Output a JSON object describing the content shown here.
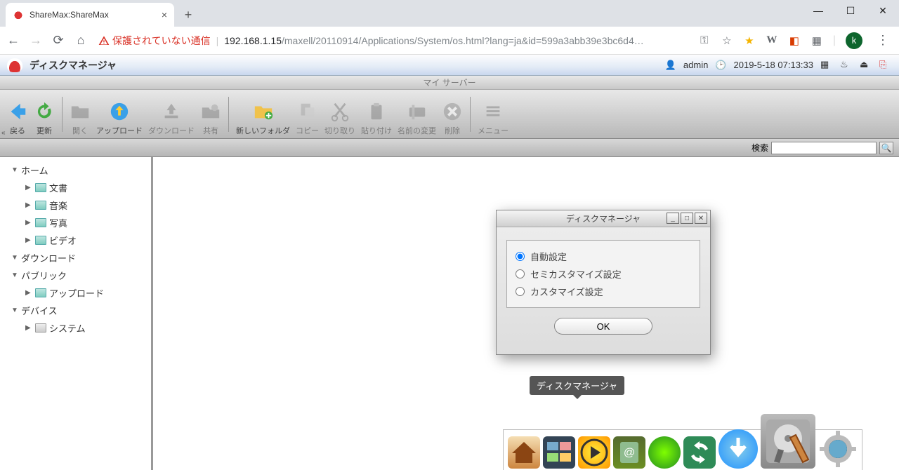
{
  "browser": {
    "tab_title": "ShareMax:ShareMax",
    "security_warning": "保護されていない通信",
    "url_host": "192.168.1.15",
    "url_path": "/maxell/20110914/Applications/System/os.html?lang=ja&id=599a3abb39e3bc6d4…",
    "avatar_letter": "k"
  },
  "app": {
    "title": "ディスクマネージャ",
    "user": "admin",
    "datetime": "2019-5-18 07:13:33",
    "window_title": "マイ サーバー"
  },
  "toolbar": {
    "back": "戻る",
    "refresh": "更新",
    "open": "開く",
    "upload": "アップロード",
    "download": "ダウンロード",
    "share": "共有",
    "newfolder": "新しいフォルダ",
    "copy": "コピー",
    "cut": "切り取り",
    "paste": "貼り付け",
    "rename": "名前の変更",
    "delete": "削除",
    "menu": "メニュー"
  },
  "search": {
    "label": "検索",
    "value": ""
  },
  "tree": {
    "home": "ホーム",
    "home_children": [
      "文書",
      "音楽",
      "写真",
      "ビデオ"
    ],
    "download": "ダウンロード",
    "public": "パブリック",
    "public_children": [
      "アップロード"
    ],
    "device": "デバイス",
    "device_children": [
      "システム"
    ]
  },
  "dialog": {
    "title": "ディスクマネージャ",
    "opt_auto": "自動設定",
    "opt_semi": "セミカスタマイズ設定",
    "opt_custom": "カスタマイズ設定",
    "ok": "OK"
  },
  "dock": {
    "tooltip": "ディスクマネージャ"
  }
}
